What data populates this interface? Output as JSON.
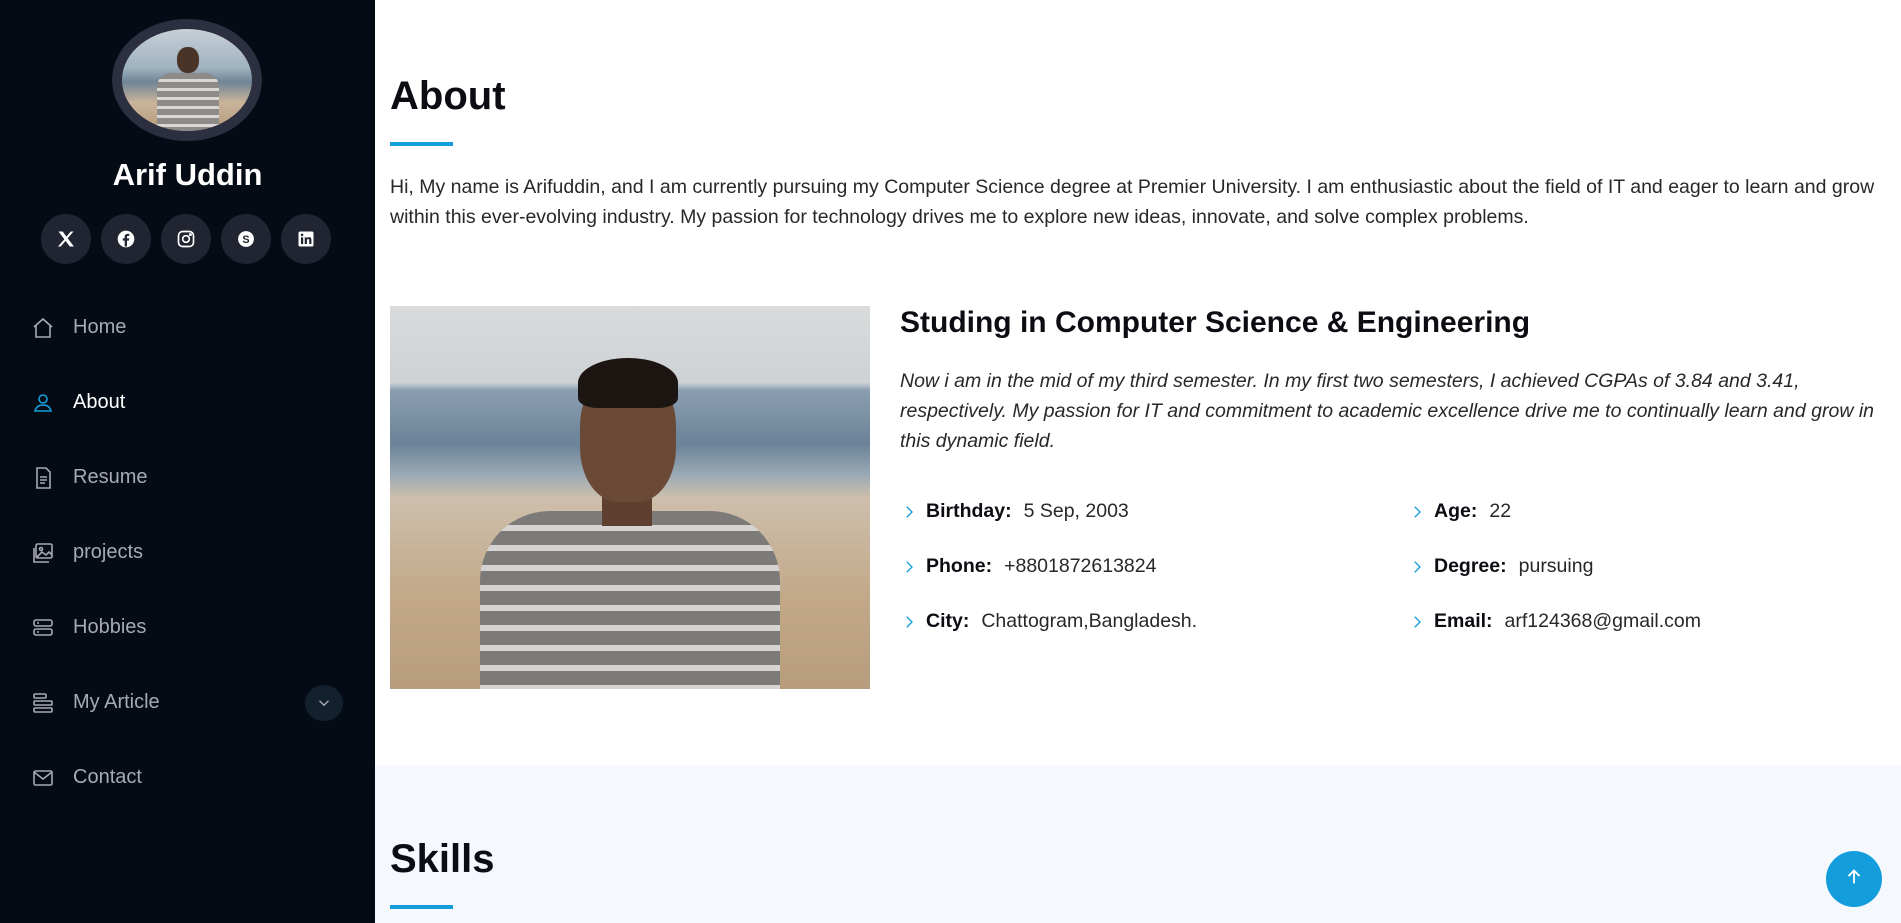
{
  "sidebar": {
    "profile_name": "Arif Uddin",
    "social": [
      {
        "icon": "x-twitter-icon"
      },
      {
        "icon": "facebook-icon"
      },
      {
        "icon": "instagram-icon"
      },
      {
        "icon": "skype-icon"
      },
      {
        "icon": "linkedin-icon"
      }
    ],
    "nav": [
      {
        "label": "Home",
        "icon": "house-icon",
        "active": false
      },
      {
        "label": "About",
        "icon": "person-icon",
        "active": true
      },
      {
        "label": "Resume",
        "icon": "file-text-icon",
        "active": false
      },
      {
        "label": "projects",
        "icon": "images-icon",
        "active": false
      },
      {
        "label": "Hobbies",
        "icon": "server-icon",
        "active": false
      },
      {
        "label": "My Article",
        "icon": "menu-stack-icon",
        "active": false,
        "has_dropdown": true
      },
      {
        "label": "Contact",
        "icon": "envelope-icon",
        "active": false
      }
    ]
  },
  "about": {
    "title": "About",
    "intro": "Hi, My name is Arifuddin, and I am currently pursuing my Computer Science degree at Premier University. I am enthusiastic about the field of IT and eager to learn and grow within this ever-evolving industry. My passion for technology drives me to explore new ideas, innovate, and solve complex problems.",
    "heading": "Studing in Computer Science & Engineering",
    "description": "Now i am in the mid of my third semester. In my first two semesters, I achieved CGPAs of 3.84 and 3.41, respectively. My passion for IT and commitment to academic excellence drive me to continually learn and grow in this dynamic field.",
    "facts": [
      {
        "label": "Birthday:",
        "value": "5 Sep, 2003"
      },
      {
        "label": "Age:",
        "value": "22"
      },
      {
        "label": "Phone:",
        "value": "+8801872613824"
      },
      {
        "label": "Degree:",
        "value": "pursuing"
      },
      {
        "label": "City:",
        "value": "Chattogram,Bangladesh."
      },
      {
        "label": "Email:",
        "value": "arf124368@gmail.com"
      }
    ]
  },
  "skills": {
    "title": "Skills"
  },
  "colors": {
    "accent": "#149ddd",
    "sidebar_bg": "#040b14",
    "skills_bg": "#f5f8fd"
  }
}
